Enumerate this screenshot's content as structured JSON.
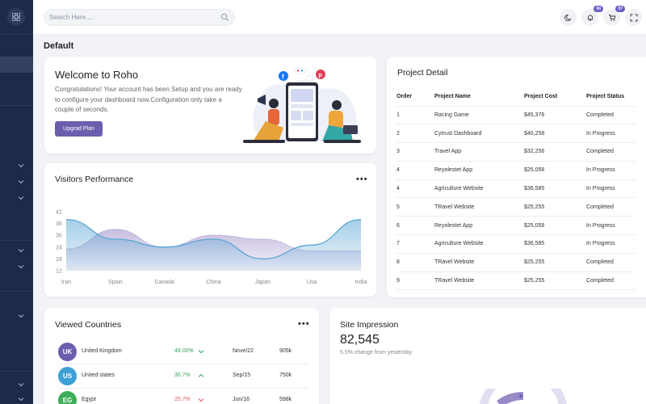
{
  "header": {
    "search_placeholder": "Search Here.....",
    "notification_count": "04",
    "cart_count": "07"
  },
  "page_title": "Default",
  "welcome": {
    "title": "Welcome to Roho",
    "text": "Congratulations! Your account has been Setup and you are ready to configure your dashboard now.Configuration only take a couple of seconds.",
    "button": "Upgrad Plan"
  },
  "project_detail": {
    "title": "Project Detail",
    "columns": [
      "Order",
      "Project Name",
      "Project Cost",
      "Project Status"
    ],
    "rows": [
      [
        "1",
        "Racing Game",
        "$45,376",
        "Completed"
      ],
      [
        "2",
        "Cytrust Dashboard",
        "$40,258",
        "In Progress"
      ],
      [
        "3",
        "Travel App",
        "$32,256",
        "Completed"
      ],
      [
        "4",
        "Reyolestet App",
        "$25,058",
        "In Progress"
      ],
      [
        "4",
        "Agriculture Website",
        "$36,585",
        "In Progress"
      ],
      [
        "5",
        "TRavel Website",
        "$25,255",
        "Completed"
      ],
      [
        "6",
        "Reyolestet App",
        "$25,058",
        "In Progress"
      ],
      [
        "7",
        "Agriculture Website",
        "$36,585",
        "In Progress"
      ],
      [
        "8",
        "TRavel Website",
        "$25,255",
        "Completed"
      ],
      [
        "9",
        "TRavel Website",
        "$25,255",
        "Completed"
      ]
    ]
  },
  "visitors": {
    "title": "Visitors Performance",
    "menu_icon": "more-icon"
  },
  "chart_data": {
    "type": "area",
    "title": "Visitors Performance",
    "categories": [
      "Iran",
      "Spain",
      "Canada",
      "China",
      "Japan",
      "Usa",
      "India"
    ],
    "yticks": [
      12,
      18,
      24,
      30,
      36,
      42
    ],
    "ylim": [
      12,
      44
    ],
    "grid": false,
    "series": [
      {
        "color": "#5aa7d4",
        "values": [
          38,
          28,
          24,
          28,
          18,
          25,
          38
        ]
      },
      {
        "color": "#9b8ac8",
        "values": [
          23,
          33,
          24,
          30,
          28,
          22,
          22
        ]
      }
    ]
  },
  "countries": {
    "title": "Viewed Countries",
    "rows": [
      {
        "code": "UK",
        "name": "United Kingdom",
        "pct": "48.00%",
        "trend": "down",
        "date": "Nove/22",
        "value": "905k",
        "color": "#6a5fad"
      },
      {
        "code": "US",
        "name": "United states",
        "pct": "30.7%",
        "trend": "up",
        "date": "Sep/15",
        "value": "750k",
        "color": "#3ea0d4"
      },
      {
        "code": "EG",
        "name": "Egypt",
        "pct": "25.7%",
        "trend": "down",
        "date": "Jun/16",
        "value": "598k",
        "color": "#3fae5a"
      }
    ],
    "colors": {
      "positive": "#3aa35a",
      "negative": "#e05a5a"
    }
  },
  "impression": {
    "title": "Site Impression",
    "value": "82,545",
    "subtitle": "5.5% change from yesterday"
  },
  "illustration": {
    "social_icons": [
      "facebook-icon",
      "pinterest-icon",
      "megaphone-icon"
    ]
  }
}
